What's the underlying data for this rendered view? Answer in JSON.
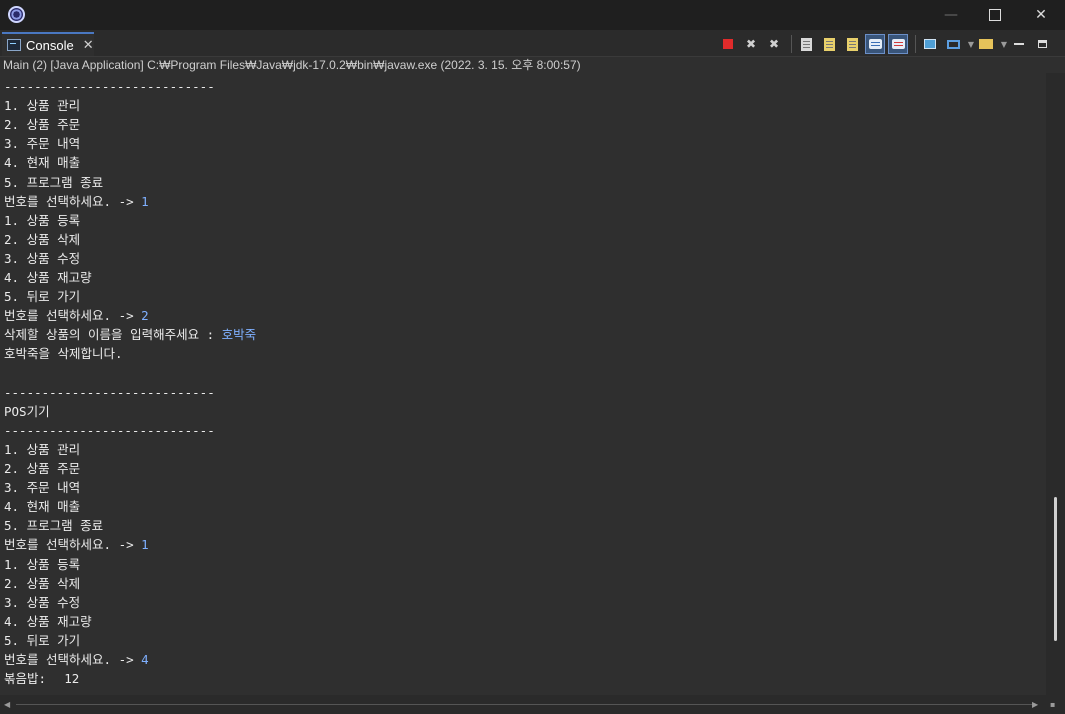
{
  "window": {
    "app_icon": "eclipse-icon",
    "minimize_glyph": "—",
    "close_glyph": "✕"
  },
  "tab": {
    "label": "Console",
    "icon": "console-icon",
    "close_glyph": "✕"
  },
  "toolbar": {
    "buttons": [
      "terminate-icon",
      "remove-launch-icon",
      "remove-all-terminated-icon",
      "scroll-lock-icon",
      "word-wrap-icon",
      "show-on-stdout-icon",
      "show-on-stderr-icon",
      "pin-console-icon",
      "display-selected-console-icon",
      "open-console-icon"
    ]
  },
  "pathbar": {
    "text": "Main (2) [Java Application] C:₩Program Files₩Java₩jdk-17.0.2₩bin₩javaw.exe  (2022. 3. 15. 오후 8:00:57)"
  },
  "console": {
    "lines": [
      {
        "text": "----------------------------",
        "input": ""
      },
      {
        "text": "1. 상품 관리",
        "input": ""
      },
      {
        "text": "2. 상품 주문",
        "input": ""
      },
      {
        "text": "3. 주문 내역",
        "input": ""
      },
      {
        "text": "4. 현재 매출",
        "input": ""
      },
      {
        "text": "5. 프로그램 종료",
        "input": ""
      },
      {
        "text": "번호를 선택하세요. -> ",
        "input": "1"
      },
      {
        "text": "1. 상품 등록",
        "input": ""
      },
      {
        "text": "2. 상품 삭제",
        "input": ""
      },
      {
        "text": "3. 상품 수정",
        "input": ""
      },
      {
        "text": "4. 상품 재고량",
        "input": ""
      },
      {
        "text": "5. 뒤로 가기",
        "input": ""
      },
      {
        "text": "번호를 선택하세요. -> ",
        "input": "2"
      },
      {
        "text": "삭제할 상품의 이름을 입력해주세요 : ",
        "input": "호박죽"
      },
      {
        "text": "호박죽을 삭제합니다.",
        "input": ""
      },
      {
        "text": "",
        "input": ""
      },
      {
        "text": "----------------------------",
        "input": ""
      },
      {
        "text": "POS기기",
        "input": ""
      },
      {
        "text": "----------------------------",
        "input": ""
      },
      {
        "text": "1. 상품 관리",
        "input": ""
      },
      {
        "text": "2. 상품 주문",
        "input": ""
      },
      {
        "text": "3. 주문 내역",
        "input": ""
      },
      {
        "text": "4. 현재 매출",
        "input": ""
      },
      {
        "text": "5. 프로그램 종료",
        "input": ""
      },
      {
        "text": "번호를 선택하세요. -> ",
        "input": "1"
      },
      {
        "text": "1. 상품 등록",
        "input": ""
      },
      {
        "text": "2. 상품 삭제",
        "input": ""
      },
      {
        "text": "3. 상품 수정",
        "input": ""
      },
      {
        "text": "4. 상품 재고량",
        "input": ""
      },
      {
        "text": "5. 뒤로 가기",
        "input": ""
      },
      {
        "text": "번호를 선택하세요. -> ",
        "input": "4"
      },
      {
        "text": "볶음밥:\t12",
        "input": ""
      },
      {
        "text": "----------------------------",
        "input": ""
      }
    ]
  }
}
